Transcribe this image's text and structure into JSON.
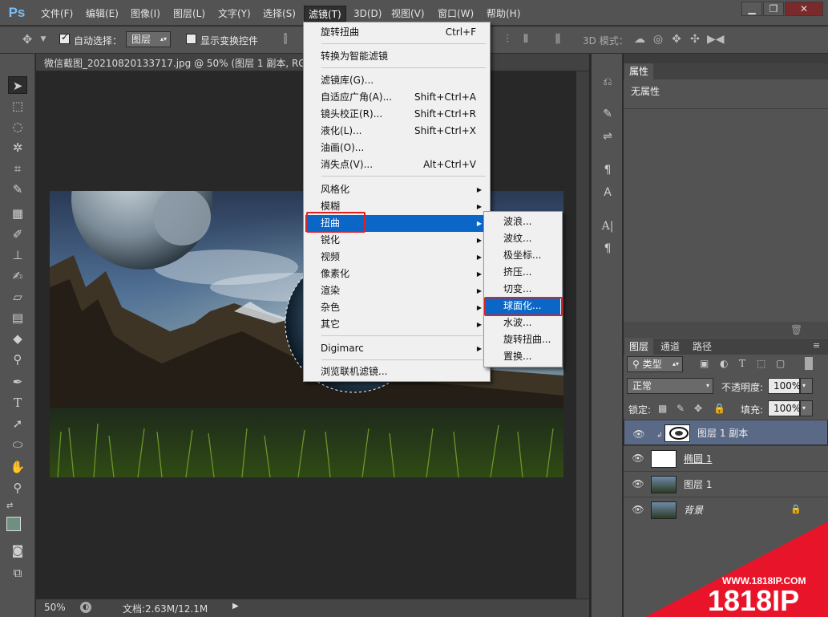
{
  "app": {
    "logo": "Ps"
  },
  "menubar": {
    "items": [
      "文件(F)",
      "编辑(E)",
      "图像(I)",
      "图层(L)",
      "文字(Y)",
      "选择(S)",
      "滤镜(T)",
      "3D(D)",
      "视图(V)",
      "窗口(W)",
      "帮助(H)"
    ],
    "active_index": 6
  },
  "window_controls": {
    "minimize": "▁",
    "restore": "❐",
    "close": "✕"
  },
  "options_bar": {
    "auto_select_label": "自动选择：",
    "auto_select_checked": true,
    "target_value": "图层",
    "show_transform_label": "显示变换控件",
    "show_transform_checked": false,
    "mode_3d_label": "3D 模式："
  },
  "document": {
    "tab_title": "微信截图_20210820133717.jpg @ 50% (图层 1 副本, RGB/8",
    "zoom": "50%",
    "doc_size": "文档:2.63M/12.1M"
  },
  "filter_menu": {
    "items": [
      {
        "label": "旋转扭曲",
        "shortcut": "Ctrl+F"
      },
      {
        "label": "转换为智能滤镜",
        "shortcut": ""
      },
      {
        "label": "滤镜库(G)...",
        "shortcut": ""
      },
      {
        "label": "自适应广角(A)...",
        "shortcut": "Shift+Ctrl+A"
      },
      {
        "label": "镜头校正(R)...",
        "shortcut": "Shift+Ctrl+R"
      },
      {
        "label": "液化(L)...",
        "shortcut": "Shift+Ctrl+X"
      },
      {
        "label": "油画(O)...",
        "shortcut": ""
      },
      {
        "label": "消失点(V)...",
        "shortcut": "Alt+Ctrl+V"
      },
      {
        "label": "风格化",
        "shortcut": ""
      },
      {
        "label": "模糊",
        "shortcut": ""
      },
      {
        "label": "扭曲",
        "shortcut": ""
      },
      {
        "label": "锐化",
        "shortcut": ""
      },
      {
        "label": "视频",
        "shortcut": ""
      },
      {
        "label": "像素化",
        "shortcut": ""
      },
      {
        "label": "渲染",
        "shortcut": ""
      },
      {
        "label": "杂色",
        "shortcut": ""
      },
      {
        "label": "其它",
        "shortcut": ""
      },
      {
        "label": "Digimarc",
        "shortcut": ""
      },
      {
        "label": "浏览联机滤镜...",
        "shortcut": ""
      }
    ],
    "highlighted": "扭曲"
  },
  "distort_submenu": {
    "items": [
      "波浪...",
      "波纹...",
      "极坐标...",
      "挤压...",
      "切变...",
      "球面化...",
      "水波...",
      "旋转扭曲...",
      "置换..."
    ],
    "highlighted": "球面化..."
  },
  "properties_panel": {
    "tab": "属性",
    "content": "无属性"
  },
  "layers_panel": {
    "tabs": [
      "图层",
      "通道",
      "路径"
    ],
    "filter_type": "类型",
    "blend_mode": "正常",
    "opacity_label": "不透明度:",
    "opacity_value": "100%",
    "lock_label": "锁定:",
    "fill_label": "填充:",
    "fill_value": "100%",
    "layers": [
      {
        "name": "图层 1 副本",
        "selected": true
      },
      {
        "name": "椭圆 1",
        "selected": false
      },
      {
        "name": "图层 1",
        "selected": false
      },
      {
        "name": "背景",
        "selected": false
      }
    ]
  },
  "watermark": {
    "url": "WWW.1818IP.COM",
    "brand": "1818IP"
  },
  "colors": {
    "accent": "#0a67c8",
    "highlight_box": "#e02020",
    "panel": "#535353",
    "selected_layer": "#5a6a86"
  }
}
